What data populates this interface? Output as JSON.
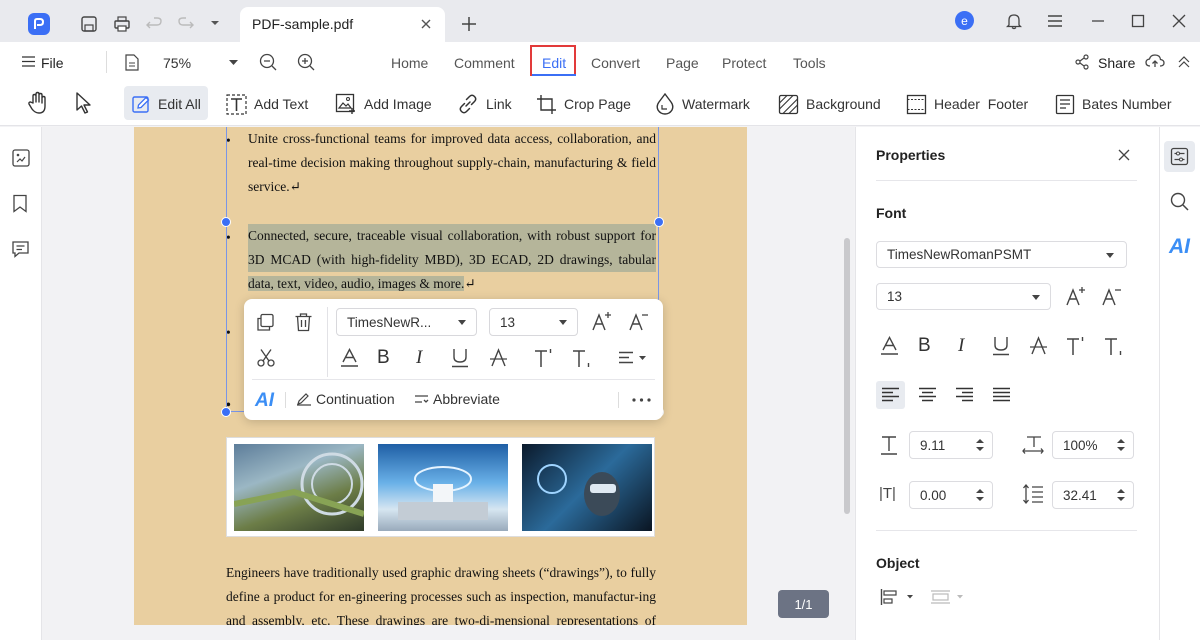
{
  "tab": {
    "title": "PDF-sample.pdf",
    "avatar_letter": "e"
  },
  "menu": {
    "file_label": "File",
    "zoom": "75%",
    "tabs": [
      "Home",
      "Comment",
      "Edit",
      "Convert",
      "Page",
      "Protect",
      "Tools"
    ],
    "share_label": "Share",
    "active_tab": "Edit"
  },
  "toolbar": {
    "edit_all": "Edit All",
    "add_text": "Add Text",
    "add_image": "Add Image",
    "link": "Link",
    "crop_page": "Crop Page",
    "watermark": "Watermark",
    "background": "Background",
    "header_footer": "Header  Footer",
    "bates_number": "Bates Number"
  },
  "document": {
    "bullet1": [
      "Unite cross-functional teams for improved data access, collaboration, and",
      "real-time decision making throughout supply-chain, manufacturing & field",
      "service.↵"
    ],
    "bullet2": [
      "Connected, secure, traceable visual collaboration, with robust support for",
      "3D MCAD (with high-fidelity MBD), 3D ECAD, 2D drawings, tabular",
      "data, text, video, audio, images & more."
    ],
    "bullet2_end": "↵",
    "para": [
      "Engineers have traditionally used graphic drawing sheets (“drawings”), to fully",
      "define a product for en-gineering processes such as inspection, manufactur-ing",
      "and assembly, etc. These drawings are two-di-mensional representations of"
    ],
    "page_indicator": "1/1"
  },
  "popup": {
    "font": "TimesNewR...",
    "size": "13",
    "continuation": "Continuation",
    "abbreviate": "Abbreviate",
    "ai_label": "AI"
  },
  "properties": {
    "title": "Properties",
    "font_section": "Font",
    "font_name": "TimesNewRomanPSMT",
    "font_size": "13",
    "line_height": "9.11",
    "scale": "100%",
    "char_spacing": "0.00",
    "para_spacing": "32.41",
    "object_section": "Object",
    "ai_label": "AI"
  },
  "colors": {
    "accent": "#3b6ff5",
    "page_bg": "#e9cfa0",
    "edit_highlight": "#e23a3a"
  }
}
